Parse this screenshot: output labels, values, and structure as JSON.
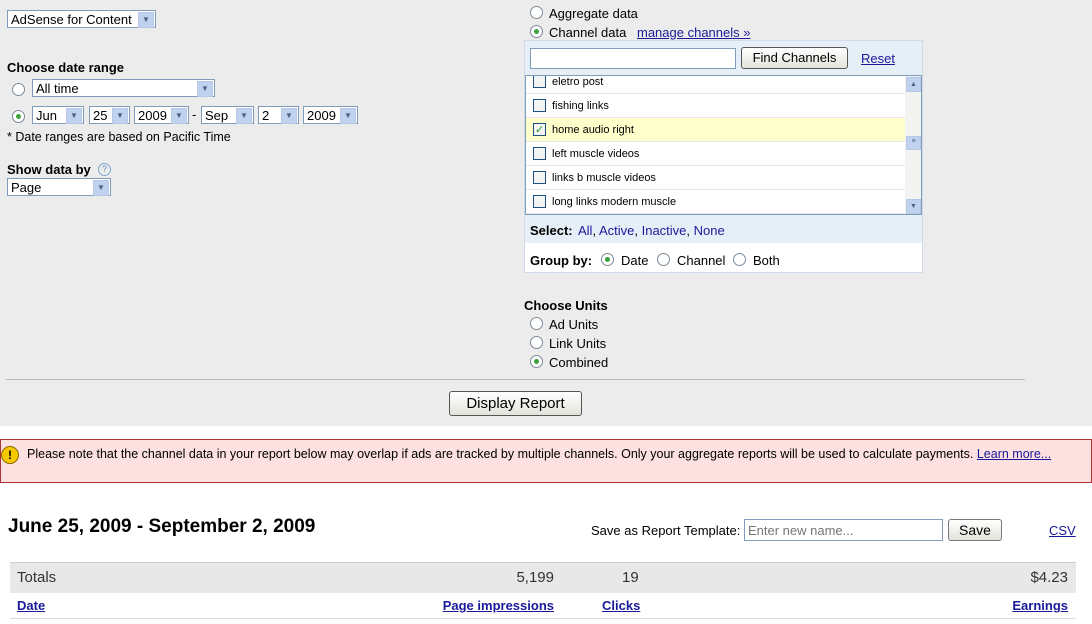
{
  "product_select": "AdSense for Content",
  "date_range": {
    "heading": "Choose date range",
    "preset": "All time",
    "from_month": "Jun",
    "from_day": "25",
    "from_year": "2009",
    "to_month": "Sep",
    "to_day": "2",
    "to_year": "2009",
    "separator": "-",
    "note": "* Date ranges are based on Pacific Time"
  },
  "show_data_by": {
    "heading": "Show data by",
    "help_icon": "?",
    "value": "Page"
  },
  "data_type": {
    "aggregate": "Aggregate data",
    "channel": "Channel data",
    "manage_link": "manage channels »"
  },
  "channels": {
    "find_button": "Find Channels",
    "reset_link": "Reset",
    "search_value": "",
    "items": [
      {
        "label": "eletro post",
        "checked": false
      },
      {
        "label": "fishing links",
        "checked": false
      },
      {
        "label": "home audio right",
        "checked": true
      },
      {
        "label": "left muscle videos",
        "checked": false
      },
      {
        "label": "links b muscle videos",
        "checked": false
      },
      {
        "label": "long links modern muscle",
        "checked": false
      }
    ],
    "select_label": "Select:",
    "select_all": "All",
    "select_active": "Active",
    "select_inactive": "Inactive",
    "select_none": "None",
    "group_by_label": "Group by:",
    "group_date": "Date",
    "group_channel": "Channel",
    "group_both": "Both"
  },
  "units": {
    "heading": "Choose Units",
    "ad": "Ad Units",
    "link": "Link Units",
    "combined": "Combined"
  },
  "display_button": "Display Report",
  "warning": {
    "text": "Please note that the channel data in your report below may overlap if ads are tracked by multiple channels. Only your aggregate reports will be used to calculate payments. ",
    "link": "Learn more..."
  },
  "report": {
    "title": "June 25, 2009 - September 2, 2009",
    "template_label": "Save as Report Template:",
    "template_placeholder": "Enter new name...",
    "save_button": "Save",
    "csv_link": "CSV",
    "totals": {
      "label": "Totals",
      "impressions": "5,199",
      "clicks": "19",
      "earnings": "$4.23"
    },
    "columns": {
      "date": "Date",
      "impressions": "Page impressions",
      "clicks": "Clicks",
      "earnings": "Earnings"
    }
  }
}
